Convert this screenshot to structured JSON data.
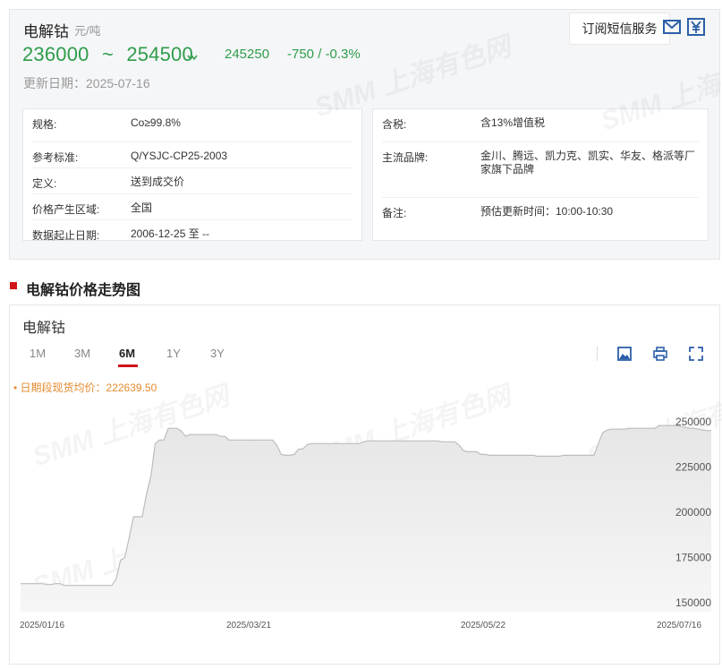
{
  "header": {
    "title": "电解钴",
    "unit": "元/吨",
    "price_low": "236000",
    "price_sep": "~",
    "price_high": "254500",
    "avg_price": "245250",
    "change": "-750 /  -0.3%",
    "update_date": "更新日期：2025-07-16",
    "subscribe_label": "订阅短信服务",
    "icons": [
      "mail-icon",
      "yuan-price-icon"
    ]
  },
  "specs_left": [
    {
      "label": "规格:",
      "value": "Co≥99.8%"
    },
    {
      "label": "参考标准:",
      "value": "Q/YSJC-CP25-2003"
    },
    {
      "label": "定义:",
      "value": "送到成交价"
    },
    {
      "label": "价格产生区域:",
      "value": "全国"
    },
    {
      "label": "数据起止日期:",
      "value": "2006-12-25 至 --"
    }
  ],
  "specs_right": [
    {
      "label": "含税:",
      "value": "含13%增值税"
    },
    {
      "label": "主流品牌:",
      "value": "金川、腾远、凯力克、凯实、华友、格派等厂家旗下品牌"
    },
    {
      "label": "备注:",
      "value": "预估更新时间：10:00-10:30"
    }
  ],
  "section_title": "电解钴价格走势图",
  "chart_panel": {
    "title": "电解钴",
    "tabs": [
      {
        "label": "1M",
        "active": false
      },
      {
        "label": "3M",
        "active": false
      },
      {
        "label": "6M",
        "active": true
      },
      {
        "label": "1Y",
        "active": false
      },
      {
        "label": "3Y",
        "active": false
      }
    ],
    "tools": [
      "image-download-icon",
      "print-icon",
      "fullscreen-icon"
    ],
    "avg_note": "• 日期段现货均价：222639.50"
  },
  "watermark": "SMM 上海有色网",
  "colors": {
    "green": "#2e9d4b",
    "red": "#d0121b",
    "orange": "#e58a2f",
    "area_fill": "#e6e6e6",
    "line": "#bdbdbd"
  },
  "chart_data": {
    "type": "area",
    "x_tick_labels": [
      "2025/01/16",
      "2025/03/21",
      "2025/05/22",
      "2025/07/16"
    ],
    "y_ticks": [
      150000,
      175000,
      200000,
      225000,
      250000
    ],
    "ylim": [
      145000,
      255000
    ],
    "grid": false,
    "series": [
      {
        "values": [
          160500,
          160500,
          160500,
          160500,
          160500,
          160500,
          160000,
          160000,
          160500,
          160500,
          159500,
          159500,
          159500,
          159500,
          159500,
          159500,
          159500,
          159500,
          159500,
          159500,
          159500,
          159500,
          163000,
          173500,
          175000,
          186000,
          197500,
          197500,
          197500,
          210000,
          220000,
          238000,
          240000,
          240000,
          246500,
          246500,
          246500,
          245000,
          242000,
          243000,
          243000,
          243000,
          243000,
          243000,
          243000,
          243000,
          242000,
          242000,
          240000,
          240000,
          240000,
          240000,
          240000,
          240000,
          240000,
          240000,
          240000,
          240000,
          240000,
          237000,
          232000,
          231500,
          231500,
          232000,
          235000,
          235000,
          237500,
          238000,
          238000,
          238000,
          238000,
          238000,
          238000,
          238000,
          238000,
          238000,
          238000,
          238000,
          238000,
          239000,
          239500,
          239500,
          239500,
          239500,
          239500,
          239500,
          239500,
          239500,
          239500,
          239500,
          239500,
          239500,
          239500,
          239500,
          239500,
          239500,
          239500,
          239000,
          239000,
          239000,
          239000,
          237000,
          234000,
          233500,
          233500,
          233500,
          232000,
          232000,
          231500,
          231500,
          231500,
          231500,
          231500,
          231500,
          231500,
          231500,
          231500,
          231500,
          231500,
          231000,
          231000,
          231000,
          231000,
          231000,
          231000,
          231500,
          231500,
          231500,
          231500,
          231500,
          231500,
          231500,
          231500,
          238000,
          244000,
          245500,
          246000,
          246000,
          246000,
          246000,
          246500,
          246500,
          246500,
          246500,
          246500,
          246500,
          246500,
          248000,
          248000,
          248000,
          248000,
          248000,
          247500,
          247000,
          246500,
          246500,
          246000,
          245500,
          245250,
          245250
        ]
      }
    ]
  }
}
